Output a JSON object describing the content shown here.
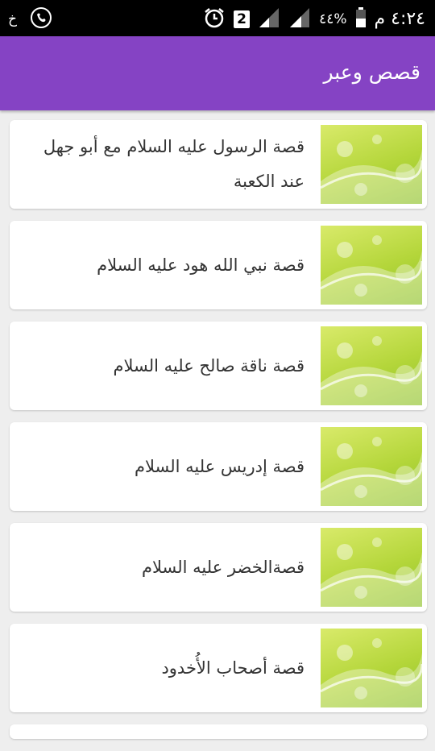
{
  "status_bar": {
    "left_icons": [
      "keyboard-icon",
      "phone-call-icon"
    ],
    "left_glyph": "ﺥ",
    "time": "٤:٢٤ م",
    "battery": "٤٤%",
    "sim_badge": "2",
    "right_icons": [
      "alarm-icon",
      "signal-icon",
      "signal-icon",
      "battery-icon"
    ]
  },
  "app_bar": {
    "title": "قصص وعبر"
  },
  "stories": [
    {
      "title": "قصة الرسول عليه السلام مع أبو جهل عند الكعبة"
    },
    {
      "title": "قصة نبي الله هود عليه السلام"
    },
    {
      "title": "قصة ناقة صالح عليه السلام"
    },
    {
      "title": "قصة إدريس عليه السلام"
    },
    {
      "title": "قصةالخضر عليه السلام"
    },
    {
      "title": "قصة أصحاب الأُخدود"
    }
  ],
  "colors": {
    "app_bar": "#8543c4",
    "thumb_green": "#b4d63a"
  }
}
